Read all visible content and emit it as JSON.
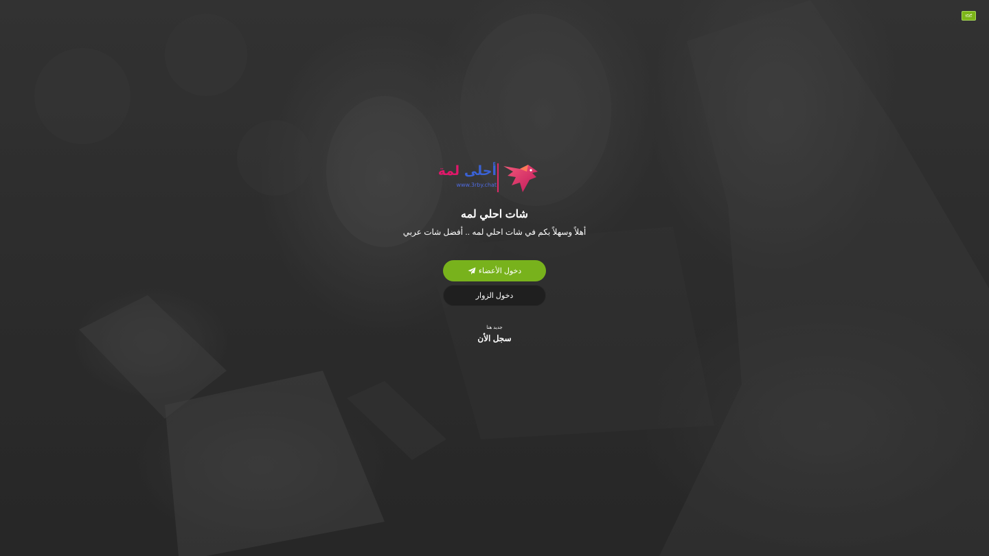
{
  "language_badge": {
    "line1": "عربي",
    "line2": "Arabic"
  },
  "logo": {
    "word1": "أحلى",
    "word2": "لمة",
    "url": "www.3rby.chat"
  },
  "title": "شات احلي لمه",
  "subtitle": "أهلاً وسهلاً بكم في شات احلي لمه .. أفضل شات عربي",
  "buttons": {
    "members_label": "دخول الأعضاء",
    "guests_label": "دخول الزوار"
  },
  "register": {
    "prompt": "جديد هنا",
    "label": "سجل الأن"
  },
  "colors": {
    "accent_green": "#78b21c",
    "guest_button": "#1f1f1f",
    "logo_blue": "#3a62d6",
    "logo_pink": "#e0186a"
  },
  "icons": {
    "members_button_icon": "paper-plane-icon",
    "logo_icon": "eagle-logo-icon"
  }
}
